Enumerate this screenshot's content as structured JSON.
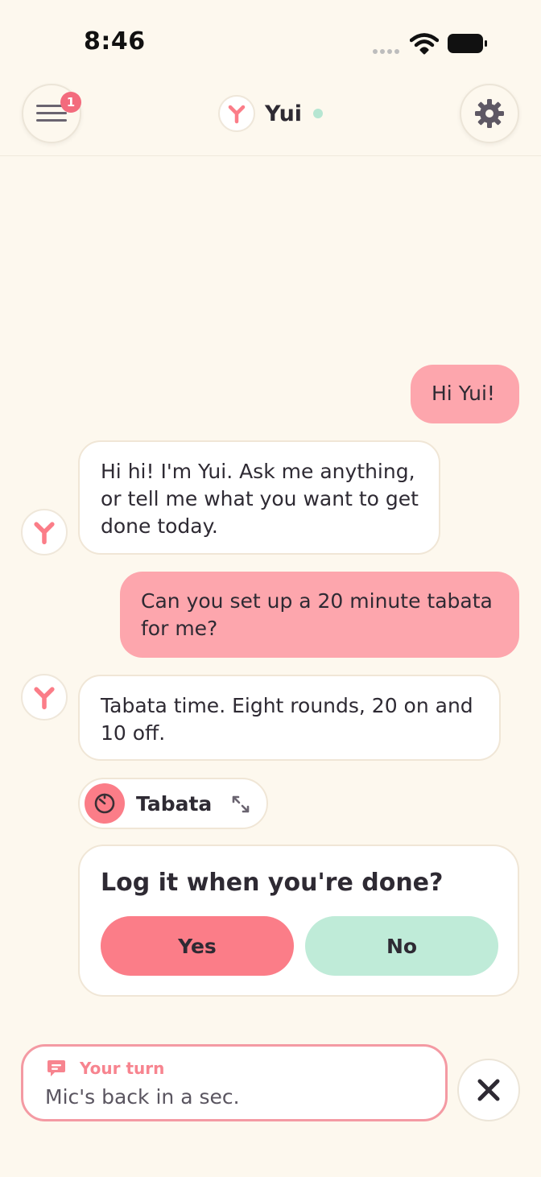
{
  "status_bar": {
    "time": "8:46"
  },
  "header": {
    "name": "Yui",
    "menu_badge": "1"
  },
  "messages": [
    {
      "role": "user",
      "text": "Hi Yui!"
    },
    {
      "role": "assistant",
      "text": "Hi hi! I'm Yui. Ask me anything, or tell me what you want to get done today."
    },
    {
      "role": "user",
      "text": "Can you set up a 20 minute tabata for me?"
    },
    {
      "role": "assistant",
      "text": "Tabata time. Eight rounds, 20 on and 10 off."
    }
  ],
  "tool_chip": {
    "label": "Tabata"
  },
  "prompt_card": {
    "title": "Log it when you're done?",
    "yes_label": "Yes",
    "no_label": "No"
  },
  "input": {
    "label": "Your turn",
    "text": "Mic's back in a sec."
  },
  "colors": {
    "background": "#fdf8ee",
    "user_bubble": "#fda6ad",
    "accent": "#fb7d88",
    "no_button": "#bfebd8",
    "online": "#b6e6d2"
  },
  "icons": {
    "menu": "hamburger-icon",
    "settings": "gear-icon",
    "avatar": "yui-logo-icon",
    "timer": "timer-icon",
    "expand": "expand-icon",
    "chat": "chat-bubble-icon",
    "close": "close-icon"
  }
}
